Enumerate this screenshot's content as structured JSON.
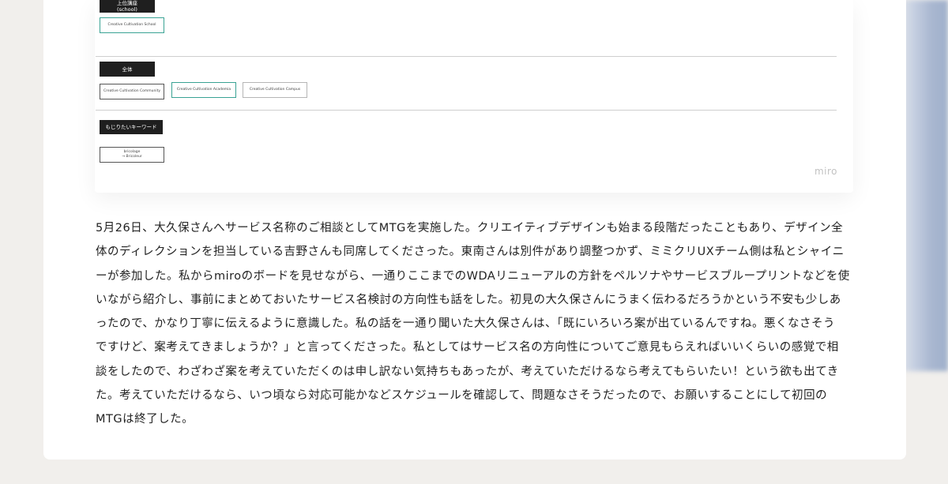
{
  "board": {
    "school_label_line1": "上位講座",
    "school_label_line2": "(school)",
    "school_chip": "Creative Cultivation School",
    "all_label": "全体",
    "all_chips": [
      "Creative Cultivation Community",
      "Creative Cultivation Academia",
      "Creative Cultivation Campus"
    ],
    "keyword_label": "もじりたいキーワード",
    "keyword_chip_line1": "bricolage",
    "keyword_chip_line2": "→ Bricoleur",
    "logo": "miro"
  },
  "article": {
    "lines": [
      "5月26日、大久保さんへサービス名称のご相談としてMTGを実施した。クリエイティブデザインも始まる段階だったこともあり、デザイン全",
      "体のディレクションを担当している吉野さんも同席してくださった。東南さんは別件があり調整つかず、ミミクリUXチーム側は私とシャイニ",
      "ーが参加した。私からmiroのボードを見せながら、一通りここまでのWDAリニューアルの方針をペルソナやサービスブループリントなどを使",
      "いながら紹介し、事前にまとめておいたサービス名検討の方向性も話をした。初見の大久保さんにうまく伝わるだろうかという不安も少しあ",
      "ったので、かなり丁寧に伝えるように意識した。私の話を一通り聞いた大久保さんは、「既にいろいろ案が出ているんですね。悪くなさそう",
      "ですけど、案考えてきましょうか？」と言ってくださった。私としてはサービス名の方向性についてご意見もらえればいいくらいの感覚で相",
      "談をしたので、わざわざ案を考えていただくのは申し訳ない気持ちもあったが、考えていただけるなら考えてもらいたい！という欲も出てき",
      "た。考えていただけるなら、いつ頃なら対応可能かなどスケジュールを確認して、問題なさそうだったので、お願いすることにして初回の",
      "MTGは終了した。"
    ]
  }
}
